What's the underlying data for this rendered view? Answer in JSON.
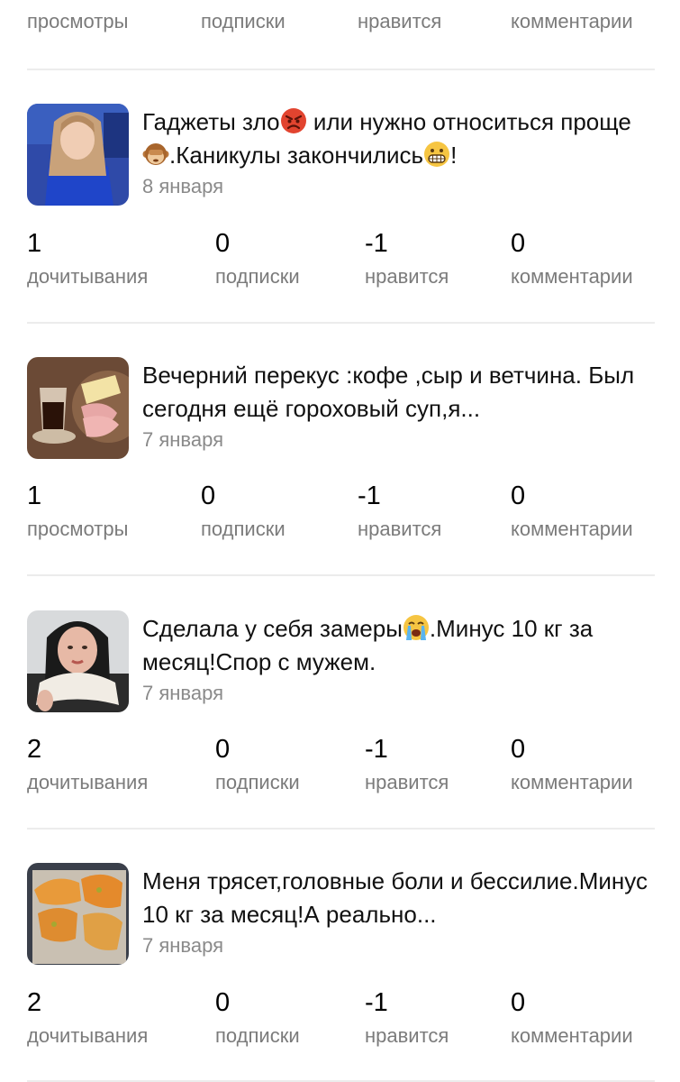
{
  "top_stats": {
    "labels": [
      "просмотры",
      "подписки",
      "нравится",
      "комментарии"
    ]
  },
  "articles": [
    {
      "title_parts": [
        "Гаджеты зло",
        "angry-emoji",
        " или нужно относиться проще",
        "monkey-emoji",
        ".Каникулы закончились",
        "grimace-emoji",
        "!"
      ],
      "date": "8 января",
      "stats": [
        {
          "value": "1",
          "label": "дочитывания"
        },
        {
          "value": "0",
          "label": "подписки"
        },
        {
          "value": "-1",
          "label": "нравится"
        },
        {
          "value": "0",
          "label": "комментарии"
        }
      ]
    },
    {
      "title_parts": [
        "Вечерний перекус :кофе ,сыр и ветчина. Был сегодня ещё гороховый суп,я..."
      ],
      "date": "7 января",
      "stats": [
        {
          "value": "1",
          "label": "просмотры"
        },
        {
          "value": "0",
          "label": "подписки"
        },
        {
          "value": "-1",
          "label": "нравится"
        },
        {
          "value": "0",
          "label": "комментарии"
        }
      ]
    },
    {
      "title_parts": [
        "Сделала у себя замеры",
        "crying-emoji",
        ".Минус 10 кг за месяц!Спор с мужем."
      ],
      "date": "7 января",
      "stats": [
        {
          "value": "2",
          "label": "дочитывания"
        },
        {
          "value": "0",
          "label": "подписки"
        },
        {
          "value": "-1",
          "label": "нравится"
        },
        {
          "value": "0",
          "label": "комментарии"
        }
      ]
    },
    {
      "title_parts": [
        "Меня трясет,головные боли и бессилие.Минус 10 кг за месяц!А реально..."
      ],
      "date": "7 января",
      "stats": [
        {
          "value": "2",
          "label": "дочитывания"
        },
        {
          "value": "0",
          "label": "подписки"
        },
        {
          "value": "-1",
          "label": "нравится"
        },
        {
          "value": "0",
          "label": "комментарии"
        }
      ]
    }
  ],
  "colors": {
    "label_gray": "#7b7b7b",
    "date_gray": "#8a8a8a",
    "divider": "#ececec"
  }
}
